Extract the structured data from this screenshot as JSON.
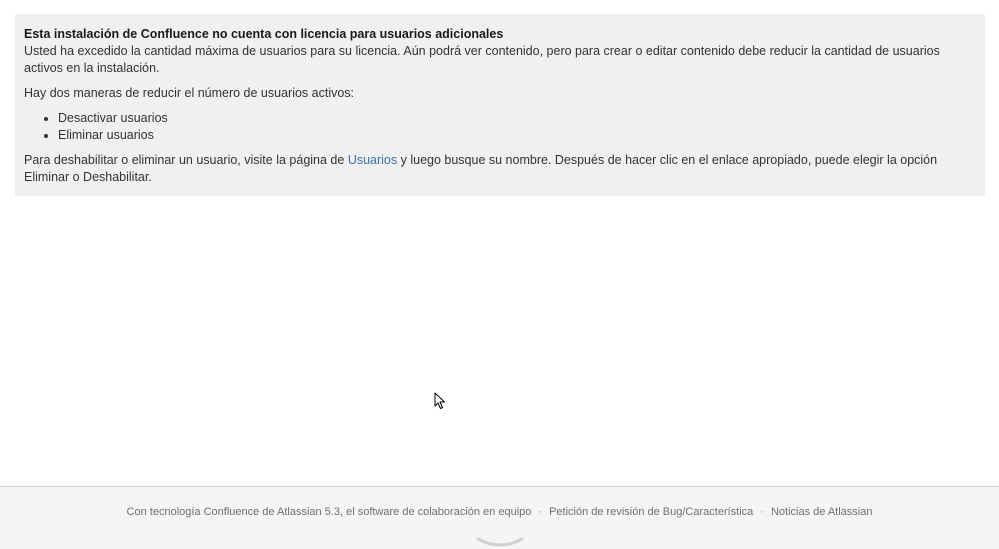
{
  "notice": {
    "title": "Esta instalación de Confluence no cuenta con licencia para usuarios adicionales",
    "paragraph1": "Usted ha excedido la cantidad máxima de usuarios para su licencia. Aún podrá ver contenido, pero para crear o editar contenido debe reducir la cantidad de usuarios activos en la instalación.",
    "paragraph2": "Hay dos maneras de reducir el número de usuarios activos:",
    "options": [
      "Desactivar usuarios",
      "Eliminar usuarios"
    ],
    "paragraph3_before": "Para deshabilitar o eliminar un usuario, visite la página de ",
    "paragraph3_link": "Usuarios",
    "paragraph3_after": " y luego busque su nombre. Después de hacer clic en el enlace apropiado, puede elegir la opción Eliminar o Deshabilitar."
  },
  "footer": {
    "powered_by": "Con tecnología Confluence de Atlassian 5.3, el software de colaboración en equipo",
    "separator": "·",
    "bug_request": "Petición de revisión de Bug/Característica",
    "news": "Noticias de Atlassian",
    "logo_icon": "atlassian-logo-icon"
  },
  "cursor": {
    "icon": "mouse-pointer-icon"
  }
}
